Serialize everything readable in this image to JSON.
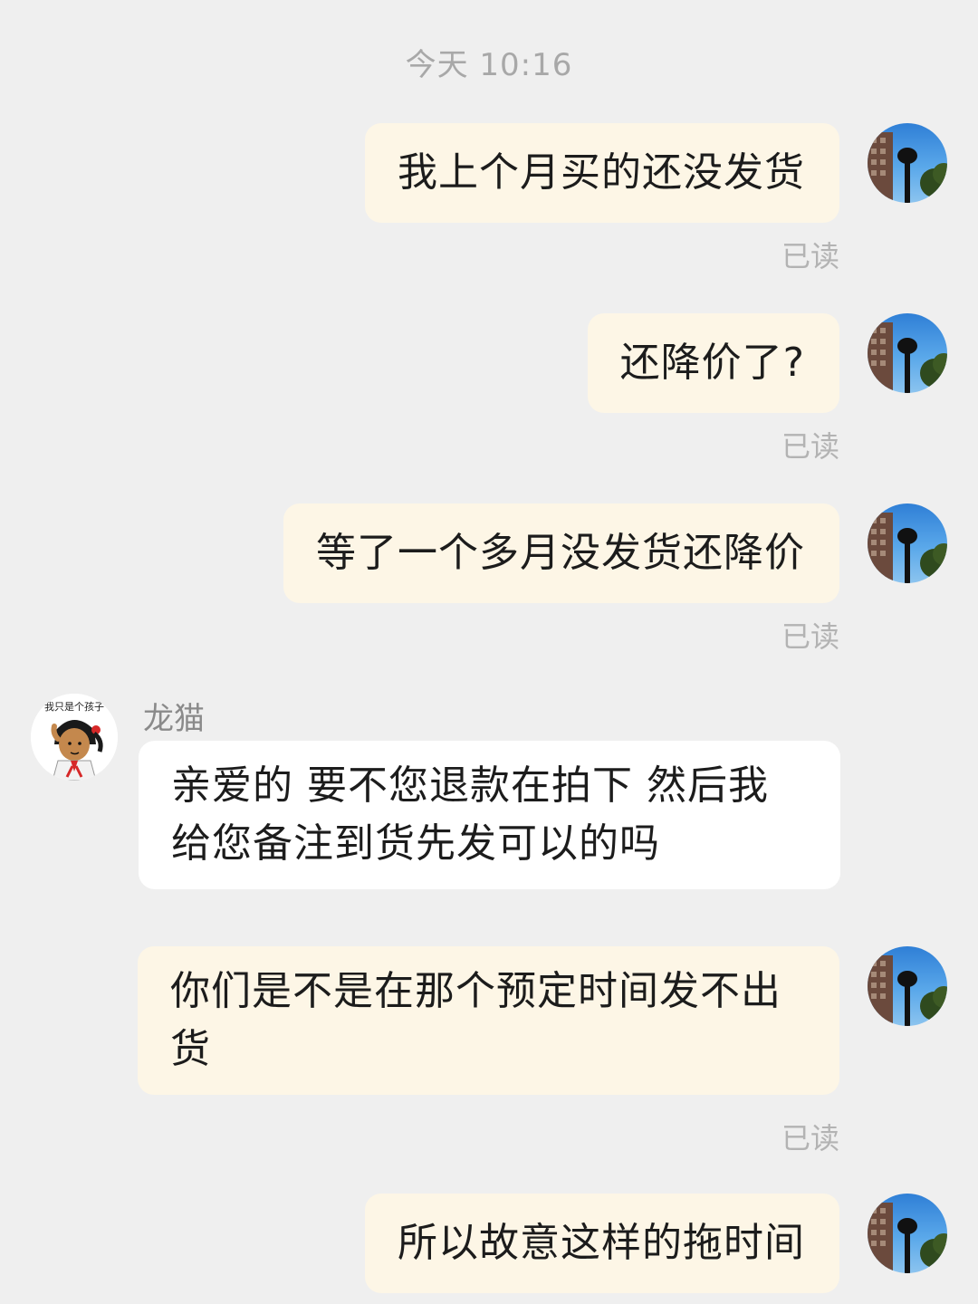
{
  "header": {
    "timestamp": "今天 10:16"
  },
  "contact": {
    "name": "龙猫",
    "avatar_caption": "我只是个孩子"
  },
  "messages": [
    {
      "from": "me",
      "text": "我上个月买的还没发货",
      "status": "已读"
    },
    {
      "from": "me",
      "text": "还降价了?",
      "status": "已读"
    },
    {
      "from": "me",
      "text": "等了一个多月没发货还降价",
      "status": "已读"
    },
    {
      "from": "other",
      "text": "亲爱的 要不您退款在拍下 然后我给您备注到货先发可以的吗"
    },
    {
      "from": "me",
      "text": "你们是不是在那个预定时间发不出货",
      "status": "已读"
    },
    {
      "from": "me",
      "text": "所以故意这样的拖时间"
    }
  ],
  "icons": {
    "my_avatar": "building-sky-avatar-icon",
    "contact_avatar": "cartoon-girl-avatar-icon"
  },
  "colors": {
    "background": "#efefef",
    "my_bubble": "#fdf6e6",
    "other_bubble": "#ffffff",
    "meta_text": "#b3b3b3"
  }
}
